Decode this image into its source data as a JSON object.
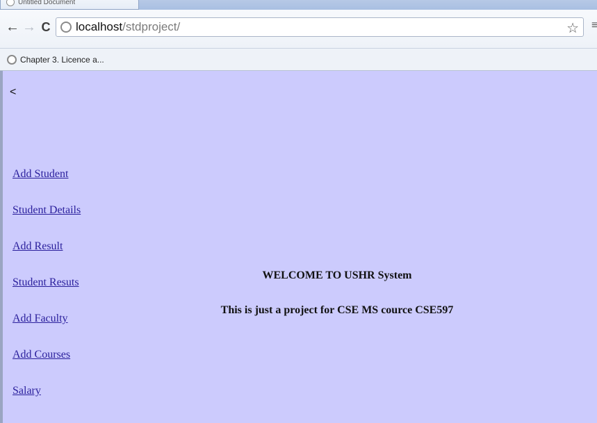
{
  "tab": {
    "title": "Untitled Document"
  },
  "toolbar": {
    "back_glyph": "←",
    "forward_glyph": "→",
    "reload_glyph": "C",
    "url_host": "localhost",
    "url_path": "/stdproject/",
    "star_glyph": "☆",
    "menu_glyph": "≡"
  },
  "bookmarks": {
    "items": [
      {
        "label": "Chapter 3. Licence a..."
      }
    ]
  },
  "page": {
    "back_text": "<",
    "links": [
      {
        "label": "Add Student"
      },
      {
        "label": "Student Details"
      },
      {
        "label": "Add Result"
      },
      {
        "label": "Student Resuts"
      },
      {
        "label": "Add Faculty"
      },
      {
        "label": "Add Courses"
      },
      {
        "label": "Salary"
      }
    ],
    "welcome": "WELCOME TO USHR System",
    "subtitle": "This is just a project for CSE MS cource CSE597"
  },
  "colors": {
    "page_background": "#cccbfd",
    "link": "#2a1f9c"
  },
  "icons": [
    "back-arrow-icon",
    "forward-arrow-icon",
    "reload-icon",
    "globe-icon",
    "star-icon",
    "menu-icon"
  ]
}
